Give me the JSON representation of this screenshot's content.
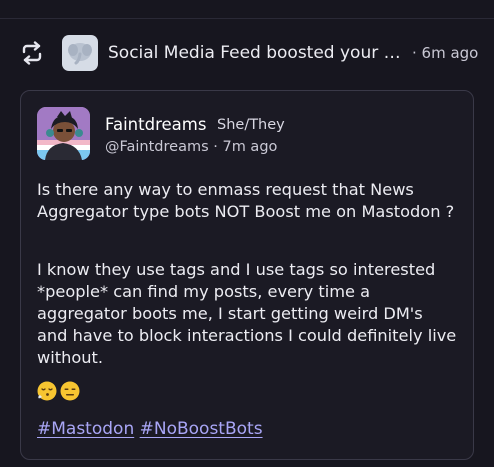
{
  "notification": {
    "text": "Social Media Feed boosted your p...",
    "time": "· 6m ago"
  },
  "post": {
    "author": {
      "display_name": "Faintdreams",
      "pronouns": "She/They",
      "handle": "@Faintdreams",
      "time": "· 7m ago"
    },
    "paragraphs": [
      "Is there any way to enmass request that News Aggregator type bots NOT Boost me on Mastodon ?",
      "I know they use tags and I use tags so interested *people* can find my posts, every time a aggregator boots me, I  start getting weird DM's and have to  block interactions I could definitely live without."
    ],
    "emojis": [
      "face-exhaling-emoji",
      "expressionless-face-emoji"
    ],
    "hashtags": [
      "#Mastodon",
      "#NoBoostBots"
    ]
  },
  "colors": {
    "background": "#17161f",
    "card_border": "#3a3948",
    "hashtag": "#a9a6f6",
    "text": "#ececf2"
  }
}
